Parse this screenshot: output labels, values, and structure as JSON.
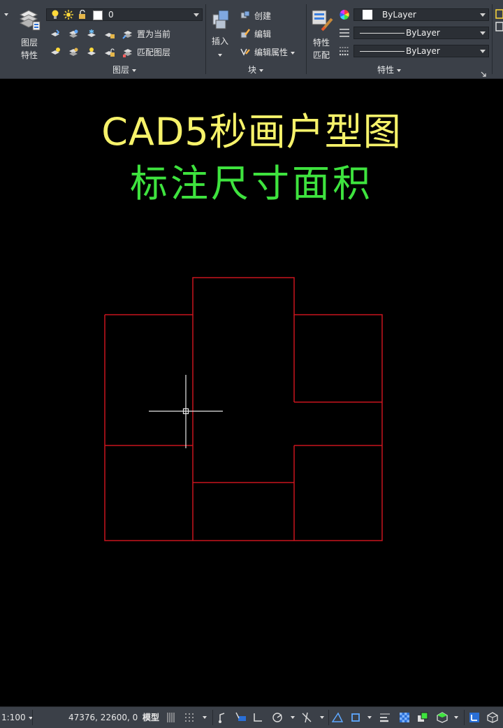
{
  "ribbon": {
    "layers_panel": {
      "title": "图层",
      "layer_props_label_line1": "图层",
      "layer_props_label_line2": "特性",
      "current_layer": "0",
      "set_current": "置为当前",
      "match_layer": "匹配图层"
    },
    "block_panel": {
      "title": "块",
      "insert": "插入",
      "create": "创建",
      "edit": "编辑",
      "edit_attributes": "编辑属性"
    },
    "properties_panel": {
      "title": "特性",
      "match_props_line1": "特性",
      "match_props_line2": "匹配",
      "color": "ByLayer",
      "linetype": "ByLayer",
      "lineweight": "ByLayer"
    }
  },
  "canvas": {
    "title_line1": "CAD5秒画户型图",
    "title_line2": "标注尺寸面积",
    "line_color": "#c8141e",
    "title1_color": "#f6f26a",
    "title2_color": "#3ee33e"
  },
  "statusbar": {
    "scale": "1:100",
    "coordinates": "47376, 22600, 0",
    "model": "模型"
  }
}
